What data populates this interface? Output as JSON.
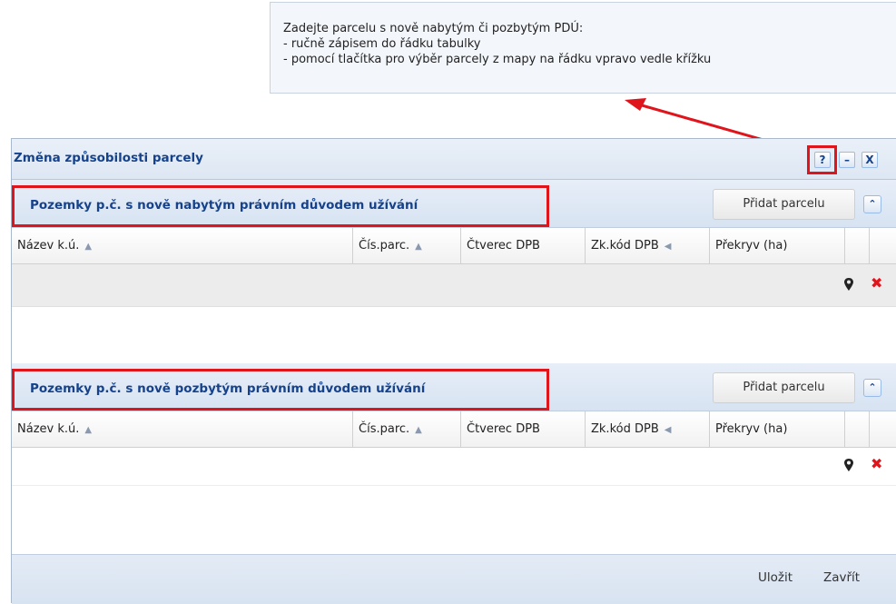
{
  "tooltip": {
    "lines": [
      "Zadejte parcelu s nově nabytým či pozbytým PDÚ:",
      "- ručně zápisem do řádku tabulky",
      "- pomocí tlačítka pro výběr parcely z mapy na řádku vpravo vedle křížku"
    ]
  },
  "dialog": {
    "title": "Změna způsobilosti parcely",
    "help_label": "?",
    "minimize_label": "–",
    "close_label": "X"
  },
  "sections": [
    {
      "title": "Pozemky p.č. s nově nabytým právním důvodem užívání",
      "add_label": "Přidat parcelu",
      "collapse_label": "⌃",
      "columns": [
        "Název k.ú.",
        "Čís.parc.",
        "Čtverec DPB",
        "Zk.kód DPB",
        "Překryv (ha)"
      ]
    },
    {
      "title": "Pozemky p.č. s nově pozbytým právním důvodem užívání",
      "add_label": "Přidat parcelu",
      "collapse_label": "⌃",
      "columns": [
        "Název k.ú.",
        "Čís.parc.",
        "Čtverec DPB",
        "Zk.kód DPB",
        "Překryv (ha)"
      ]
    }
  ],
  "footer": {
    "save_label": "Uložit",
    "close_label": "Zavřít"
  },
  "colors": {
    "highlight": "#e0141b",
    "title_blue": "#15428b"
  },
  "icons": {
    "sort": "sort-asc-icon",
    "pin": "map-pin-icon",
    "delete": "delete-x-icon"
  }
}
